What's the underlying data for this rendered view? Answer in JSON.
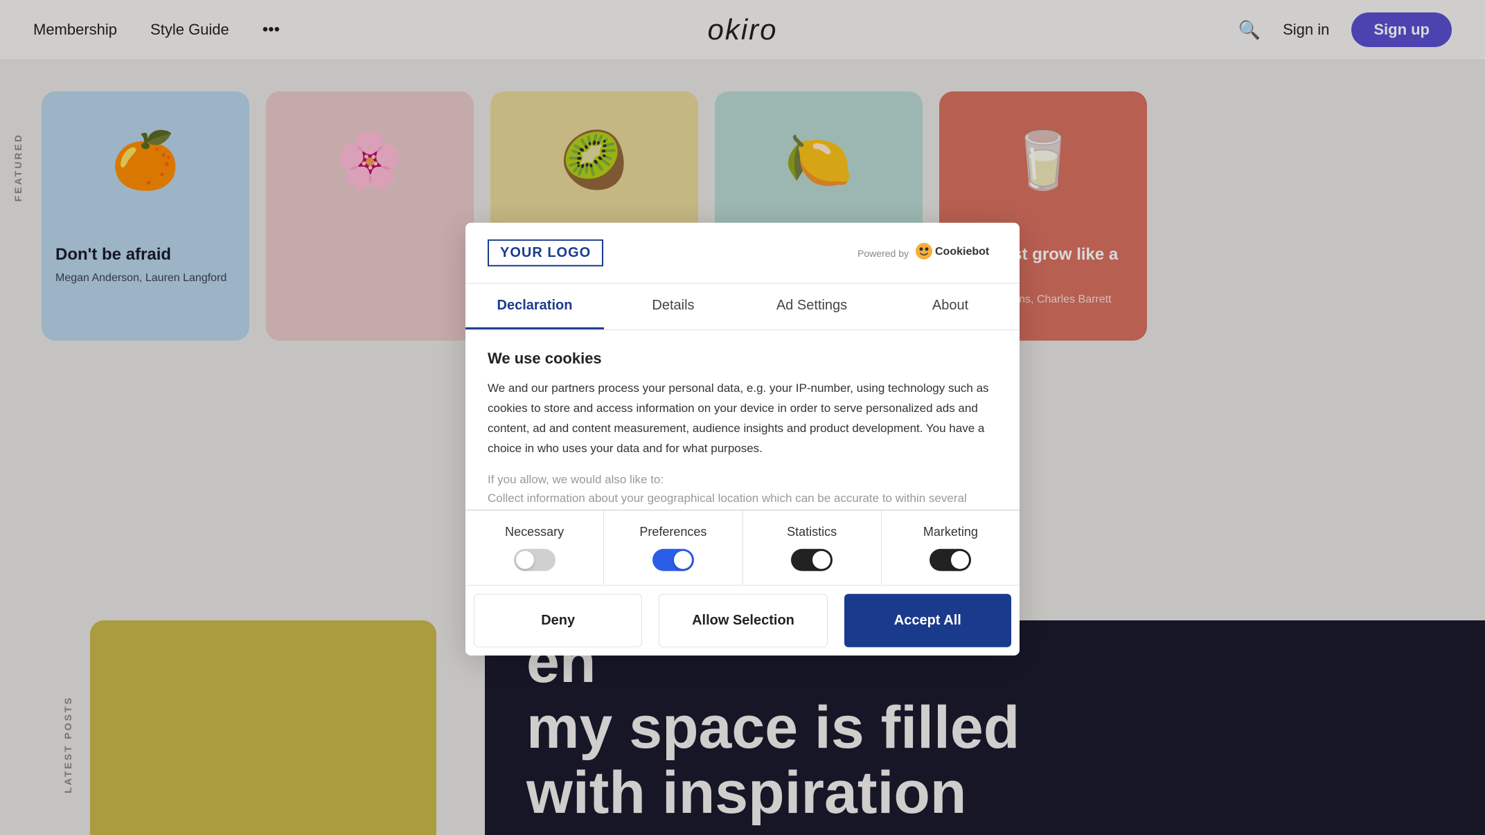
{
  "navbar": {
    "logo": "okiro",
    "links": [
      "Membership",
      "Style Guide"
    ],
    "more_label": "•••",
    "signin_label": "Sign in",
    "signup_label": "Sign up"
  },
  "sidebar": {
    "featured_label": "FEATURED",
    "latest_posts_label": "LATEST POSTS"
  },
  "cards": [
    {
      "bg_color": "#b8d4e8",
      "emoji": "🍊",
      "title": "Don't be afraid",
      "authors": "Megan Anderson, Lauren Langford"
    },
    {
      "bg_color": "#e8c8c8",
      "emoji": "🌸",
      "title": "",
      "authors": ""
    },
    {
      "bg_color": "#e8d898",
      "emoji": "🥝",
      "title": "",
      "authors": ""
    },
    {
      "bg_color": "#b8d8d0",
      "emoji": "🍋",
      "title": "",
      "authors": ""
    },
    {
      "bg_color": "#d87060",
      "emoji": "🥛",
      "title": "You must grow like a tree",
      "authors": "Patricia Jenkins, Charles Barrett"
    }
  ],
  "bottom": {
    "big_text_line1": "en",
    "big_text_line2": "my space is filled",
    "big_text_line3": "with inspiration"
  },
  "cookie_modal": {
    "logo_text": "YOUR LOGO",
    "powered_by": "Powered by",
    "cookiebot_label": "Cookiebot",
    "tabs": [
      {
        "id": "declaration",
        "label": "Declaration",
        "active": true
      },
      {
        "id": "details",
        "label": "Details",
        "active": false
      },
      {
        "id": "ad-settings",
        "label": "Ad Settings",
        "active": false
      },
      {
        "id": "about",
        "label": "About",
        "active": false
      }
    ],
    "body": {
      "title": "We use cookies",
      "main_text": "We and our partners process your personal data, e.g. your IP-number, using technology such as cookies to store and access information on your device in order to serve personalized ads and content, ad and content measurement, audience insights and product development. You have a choice in who uses your data and for what purposes.",
      "secondary_text": "If you allow, we would also like to:",
      "tertiary_text": "Collect information about your geographical location which can be accurate to within several meters."
    },
    "toggles": [
      {
        "id": "necessary",
        "label": "Necessary",
        "state": "off"
      },
      {
        "id": "preferences",
        "label": "Preferences",
        "state": "on-blue"
      },
      {
        "id": "statistics",
        "label": "Statistics",
        "state": "on-dark"
      },
      {
        "id": "marketing",
        "label": "Marketing",
        "state": "on-dark"
      }
    ],
    "buttons": {
      "deny": "Deny",
      "allow_selection": "Allow Selection",
      "accept_all": "Accept All"
    }
  }
}
